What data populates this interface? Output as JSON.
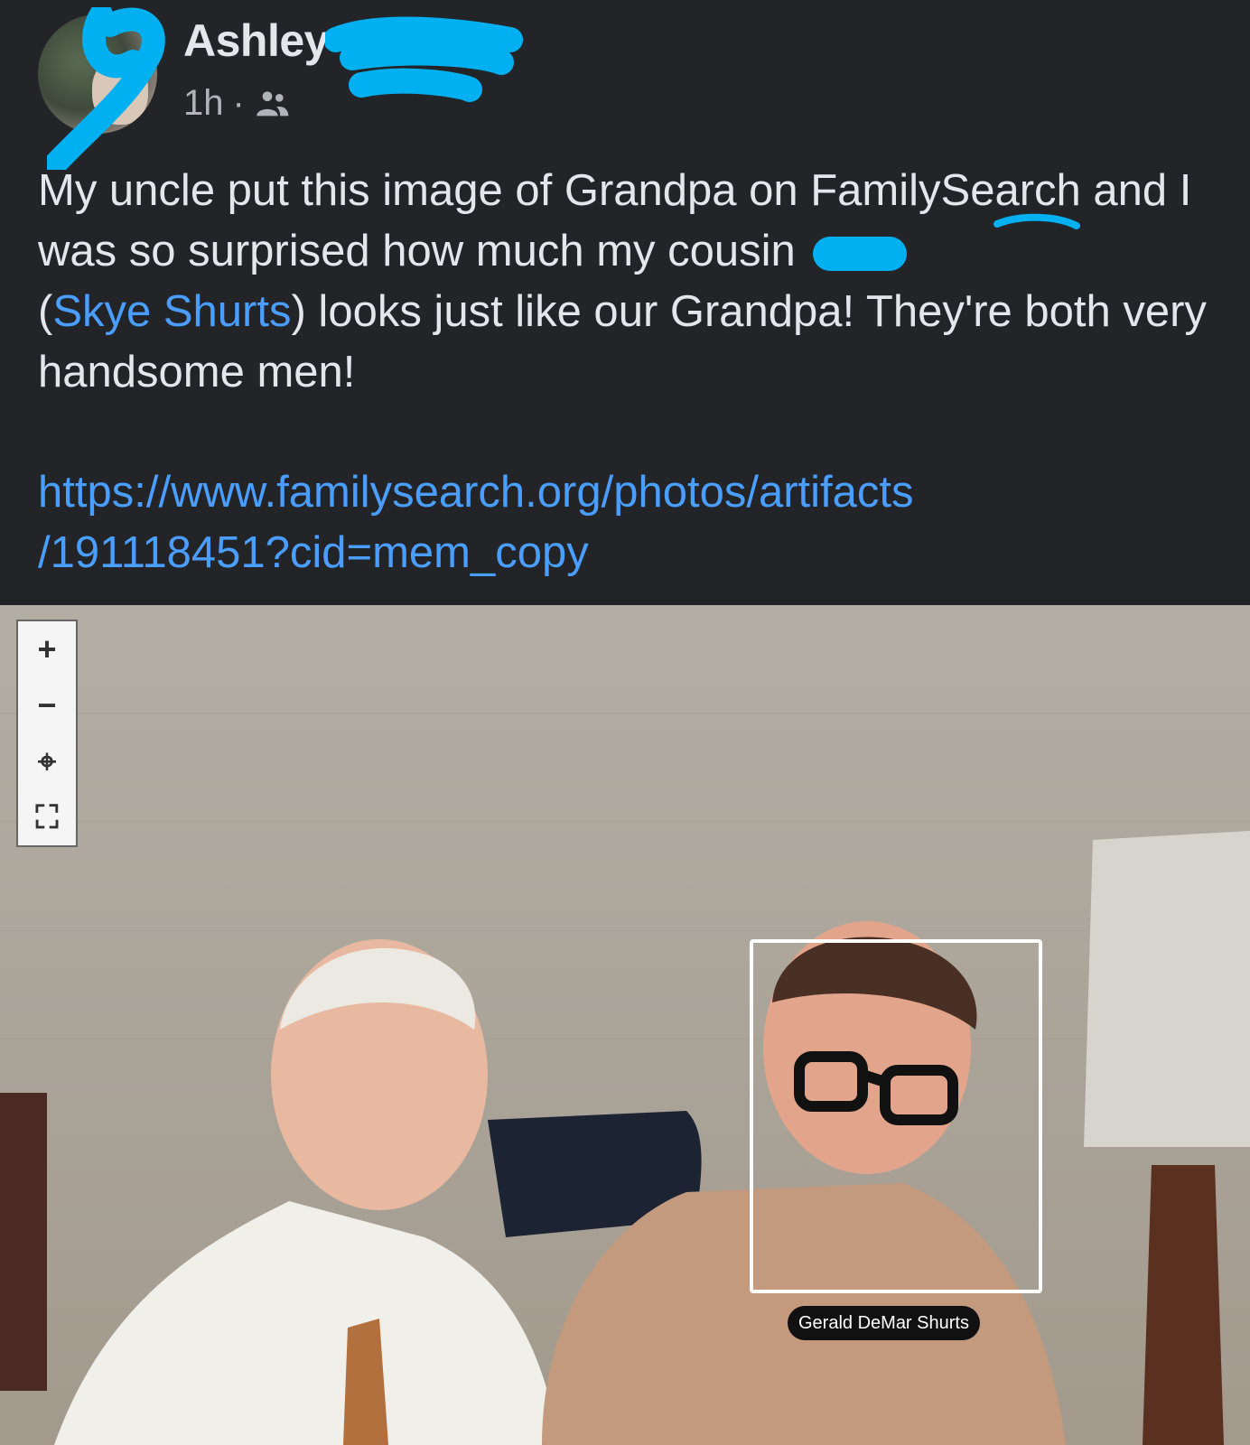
{
  "post": {
    "author": "Ashley",
    "time": "1h",
    "separator": "·",
    "audience_icon": "friends-icon",
    "body_part1": "My uncle put this image of Grandpa on FamilySearch and I was so surprised how much my cousin ",
    "body_paren_open": "(",
    "mention": "Skye Shurts",
    "body_part2": ") looks just like our Grandpa! They're both very handsome men!",
    "link_line1": "https://www.familysearch.org/photos/artifacts",
    "link_line2": "/191118451?cid=mem_copy"
  },
  "viewer": {
    "controls": [
      {
        "name": "zoom-in",
        "glyph": "+"
      },
      {
        "name": "zoom-out",
        "glyph": "−"
      },
      {
        "name": "recenter",
        "glyph": "⌖"
      },
      {
        "name": "fullscreen",
        "glyph": "⛶"
      }
    ],
    "tag_label": "Gerald DeMar Shurts"
  },
  "colors": {
    "background": "#232427",
    "text": "#e4e6eb",
    "link": "#4a9eff",
    "redaction": "#00b0f0"
  }
}
